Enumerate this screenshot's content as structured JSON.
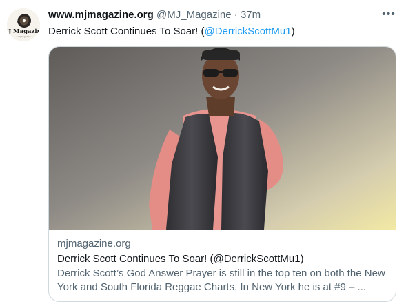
{
  "tweet": {
    "avatar": {
      "logo_text": "MJ Magazine",
      "logo_subtext": "a mjmagazine"
    },
    "author_name": "www.mjmagazine.org",
    "handle": "@MJ_Magazine",
    "separator": "·",
    "time": "37m",
    "more_label": "•••",
    "text_prefix": "Derrick Scott Continues To Soar! (",
    "mention": "@DerrickScottMu1",
    "text_suffix": ")"
  },
  "card": {
    "domain": "mjmagazine.org",
    "title": "Derrick Scott Continues To Soar! (@DerrickScottMu1)",
    "description": "Derrick Scott’s God Answer Prayer is still in the top ten on both the New York and South Florida Reggae Charts. In New York he is at #9 – ..."
  },
  "colors": {
    "link": "#1d9bf0",
    "secondary_text": "#536471",
    "border": "#cfd9de"
  }
}
